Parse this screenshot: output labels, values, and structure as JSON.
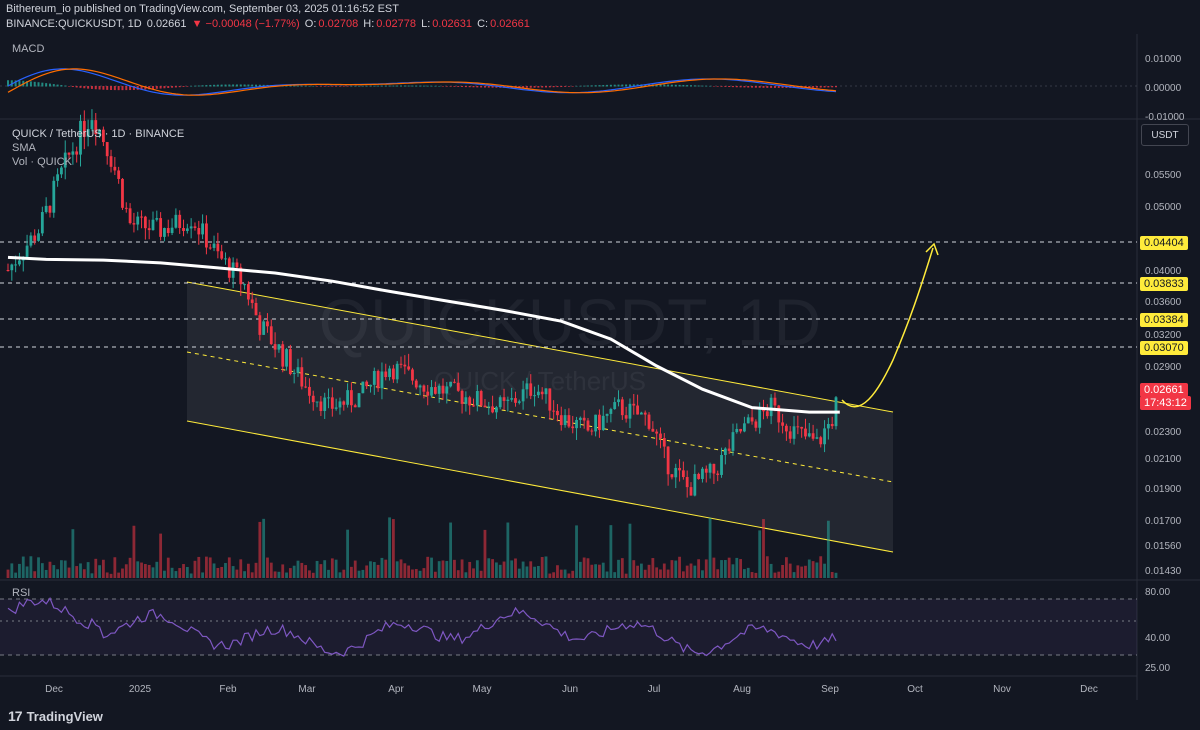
{
  "header": {
    "publisher_line": "Bithereum_io published on TradingView.com, September 03, 2025 01:16:52 EST",
    "symbol": "BINANCE:QUICKUSDT, 1D",
    "last": "0.02661",
    "change": "▼ −0.00048 (−1.77%)",
    "o_label": "O:",
    "o_value": "0.02708",
    "h_label": "H:",
    "h_value": "0.02778",
    "l_label": "L:",
    "l_value": "0.02631",
    "c_label": "C:",
    "c_value": "0.02661"
  },
  "panes": {
    "macd_label": "MACD",
    "main_title": "QUICK / TetherUS · 1D · BINANCE",
    "sma_label": "SMA",
    "vol_label": "Vol · QUICK",
    "rsi_label": "RSI",
    "watermark_main": "QUICKUSDT, 1D",
    "watermark_sub": "QUICK / TetherUS",
    "currency_button": "USDT"
  },
  "footer": {
    "logo_text": "TradingView",
    "logo_mark": "17"
  },
  "colors": {
    "bg": "#131722",
    "up": "#26a69a",
    "down": "#f23645",
    "sma": "#ffffff",
    "channel": "#ffeb3b",
    "rsi": "#7e57c2"
  },
  "chart_data": {
    "type": "candlestick",
    "symbol": "QUICKUSDT",
    "timeframe": "1D",
    "price_axis_ticks": [
      "0.05500",
      "0.05000",
      "0.04000",
      "0.03600",
      "0.03200",
      "0.02900",
      "0.02300",
      "0.02100",
      "0.01900",
      "0.01700",
      "0.01560",
      "0.01430"
    ],
    "price_axis_values": [
      0.055,
      0.05,
      0.04,
      0.036,
      0.032,
      0.029,
      0.023,
      0.021,
      0.019,
      0.017,
      0.0156,
      0.0143
    ],
    "x_ticks": [
      "Dec",
      "2025",
      "Feb",
      "Mar",
      "Apr",
      "May",
      "Jun",
      "Jul",
      "Aug",
      "Sep",
      "Oct",
      "Nov",
      "Dec"
    ],
    "horizontal_levels": [
      {
        "label": "0.04404",
        "value": 0.04404
      },
      {
        "label": "0.03833",
        "value": 0.03833
      },
      {
        "label": "0.03384",
        "value": 0.03384
      },
      {
        "label": "0.03070",
        "value": 0.0307
      }
    ],
    "current_price": {
      "label": "0.02661",
      "value": 0.02661,
      "countdown": "17:43:12"
    },
    "sma_approx": [
      {
        "t": 0,
        "v": 0.0418
      },
      {
        "t": 10,
        "v": 0.0415
      },
      {
        "t": 25,
        "v": 0.0414
      },
      {
        "t": 40,
        "v": 0.041
      },
      {
        "t": 55,
        "v": 0.0403
      },
      {
        "t": 70,
        "v": 0.0396
      },
      {
        "t": 85,
        "v": 0.0385
      },
      {
        "t": 100,
        "v": 0.0372
      },
      {
        "t": 115,
        "v": 0.036
      },
      {
        "t": 130,
        "v": 0.0348
      },
      {
        "t": 145,
        "v": 0.0335
      },
      {
        "t": 158,
        "v": 0.0315
      },
      {
        "t": 170,
        "v": 0.029
      },
      {
        "t": 182,
        "v": 0.0267
      },
      {
        "t": 195,
        "v": 0.025
      },
      {
        "t": 210,
        "v": 0.0246
      },
      {
        "t": 218,
        "v": 0.0246
      }
    ],
    "macd_axis": [
      "0.01000",
      "0.00000",
      "-0.01000"
    ],
    "macd_axis_values": [
      0.01,
      0,
      -0.01
    ],
    "rsi_axis": [
      "80.00",
      "40.00",
      "25.00"
    ],
    "rsi_axis_values": [
      80,
      40,
      25
    ]
  }
}
